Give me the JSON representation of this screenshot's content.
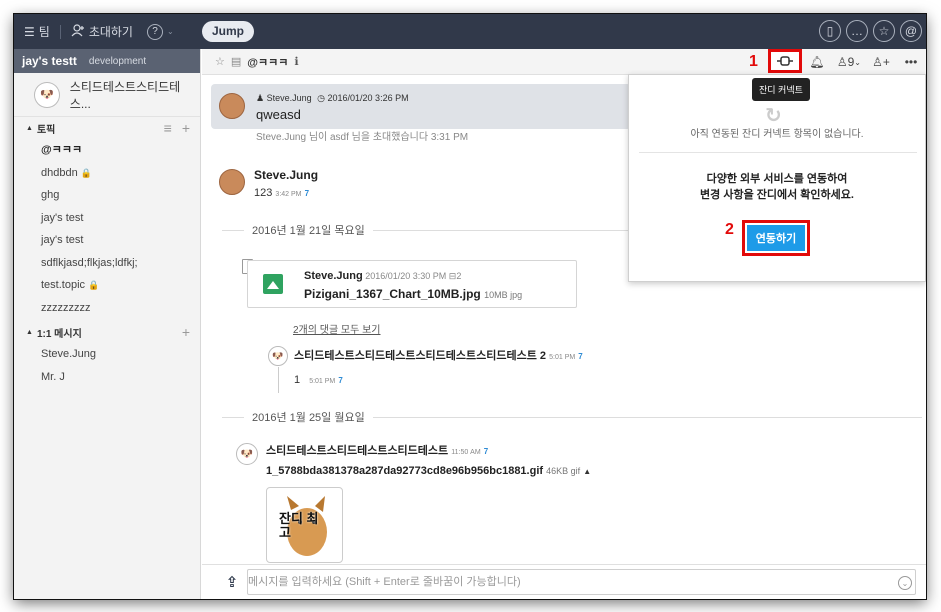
{
  "topbar": {
    "team_label": "팀",
    "invite_label": "초대하기",
    "help_icon": "question-circle-icon",
    "jump_label": "Jump",
    "right_icons": [
      "file-icon",
      "chat-icon",
      "star-icon",
      "mention-icon"
    ]
  },
  "sidebar": {
    "team_name": "jay's testt",
    "team_subtitle": "development",
    "profile_name": "스티드테스트스티드테스...",
    "topics_header": "토픽",
    "topics": [
      "@ㅋㅋㅋ",
      "dhdbdn",
      "ghg",
      "jay's test",
      "jay's test",
      "sdflkjasd;flkjas;ldfkj;",
      "test.topic",
      "zzzzzzzzz"
    ],
    "locked_topics": [
      "dhdbdn",
      "test.topic"
    ],
    "dm_header": "1:1 메시지",
    "dms": [
      "Steve.Jung",
      "Mr. J"
    ]
  },
  "main_header": {
    "title": "@ㅋㅋㅋ",
    "member_count": "9",
    "step1": "1",
    "tooltip": "잔디 커넥트"
  },
  "messages": {
    "pinned_author": "Steve.Jung",
    "pinned_time": "2016/01/20 3:26 PM",
    "pinned_text": "qweasd",
    "faded_text": "Steve.Jung 님이 asdf 님을 초대했습니다 3:31 PM",
    "msg1_author": "Steve.Jung",
    "msg1_text": "123",
    "msg1_time": "3:42 PM",
    "msg1_unread": "7",
    "date1": "2016년 1월 21일 목요일",
    "file_author": "Steve.Jung",
    "file_time": "2016/01/20 3:30 PM",
    "file_comments": "2",
    "file_name": "Pizigani_1367_Chart_10MB.jpg",
    "file_size": "10MB jpg",
    "view_comments": "2개의 댓글 모두 보기",
    "comment_author": "스티드테스트스티드테스트스티드테스트스티드테스트 2",
    "comment_time": "5:01 PM",
    "comment_unread": "7",
    "reply_text": "1",
    "reply_time": "5:01 PM",
    "reply_unread": "7",
    "date2": "2016년 1월 25일 월요일",
    "msg3_author": "스티드테스트스티드테스트스티드테스트",
    "msg3_time": "11:50 AM",
    "msg3_unread": "7",
    "gif_name": "1_5788bda381378a287da92773cd8e96b956bc1881.gif",
    "gif_size": "46KB gif",
    "sticker_text": "잔디 최고"
  },
  "composer": {
    "placeholder": "메시지를 입력하세요 (Shift + Enter로 줄바꿈이 가능합니다)"
  },
  "connect_popover": {
    "empty_text": "아직 연동된 잔디 커넥트 항목이 없습니다.",
    "line1": "다양한 외부 서비스를 연동하여",
    "line2": "변경 사항을 잔디에서 확인하세요.",
    "button_label": "연동하기",
    "step2": "2"
  },
  "colors": {
    "topbar_bg": "#31394a",
    "highlight_red": "#e20a0a",
    "button_blue": "#1e9be8",
    "unread_blue": "#2e8bd4"
  }
}
